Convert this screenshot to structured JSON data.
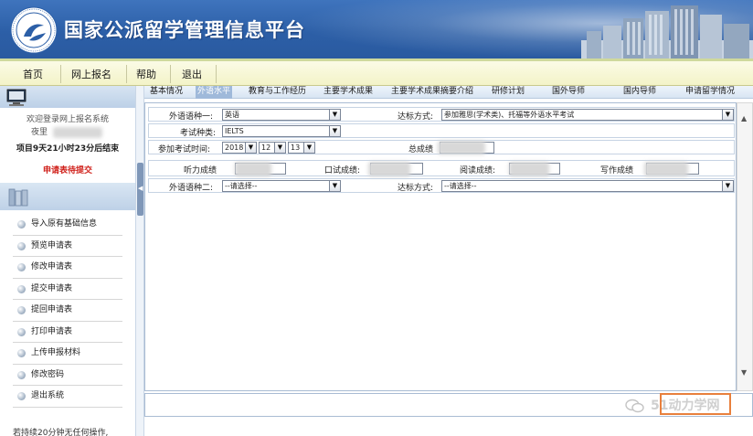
{
  "header": {
    "title": "国家公派留学管理信息平台",
    "logo_text": "国家留学基金管理委员会"
  },
  "nav": {
    "items": [
      "首页",
      "网上报名",
      "帮助",
      "退出"
    ]
  },
  "sidebar": {
    "welcome": "欢迎登录网上报名系统",
    "user_prefix": "夜里",
    "countdown": "项目9天21小时23分后结束",
    "status": "申请表待提交",
    "menu": [
      "导入原有基础信息",
      "预览申请表",
      "修改申请表",
      "提交申请表",
      "提回申请表",
      "打印申请表",
      "上传申报材料",
      "修改密码",
      "退出系统"
    ],
    "note": "若持续20分钟无任何操作,"
  },
  "tabs": {
    "items": [
      "基本情况",
      "外语水平",
      "教育与工作经历",
      "主要学术成果",
      "主要学术成果摘要介绍",
      "研修计划",
      "国外导师",
      "国内导师",
      "申请留学情况"
    ],
    "active": "外语水平"
  },
  "form": {
    "lang1_label": "外语语种一:",
    "lang1_value": "英语",
    "standard1_label": "达标方式:",
    "standard1_value": "参加雅思(学术类)、托福等外语水平考试",
    "exam_type_label": "考试种类:",
    "exam_type_value": "IELTS",
    "exam_date_label": "参加考试时间:",
    "exam_year": "2018",
    "exam_month": "12",
    "exam_day": "13",
    "total_label": "总成绩",
    "listening_label": "听力成绩",
    "speaking_label": "口试成绩:",
    "reading_label": "阅读成绩:",
    "writing_label": "写作成绩",
    "lang2_label": "外语语种二:",
    "lang2_value": "--请选择--",
    "standard2_label": "达标方式:",
    "standard2_value": "--请选择--"
  },
  "watermark": {
    "text": "51动力学网"
  }
}
